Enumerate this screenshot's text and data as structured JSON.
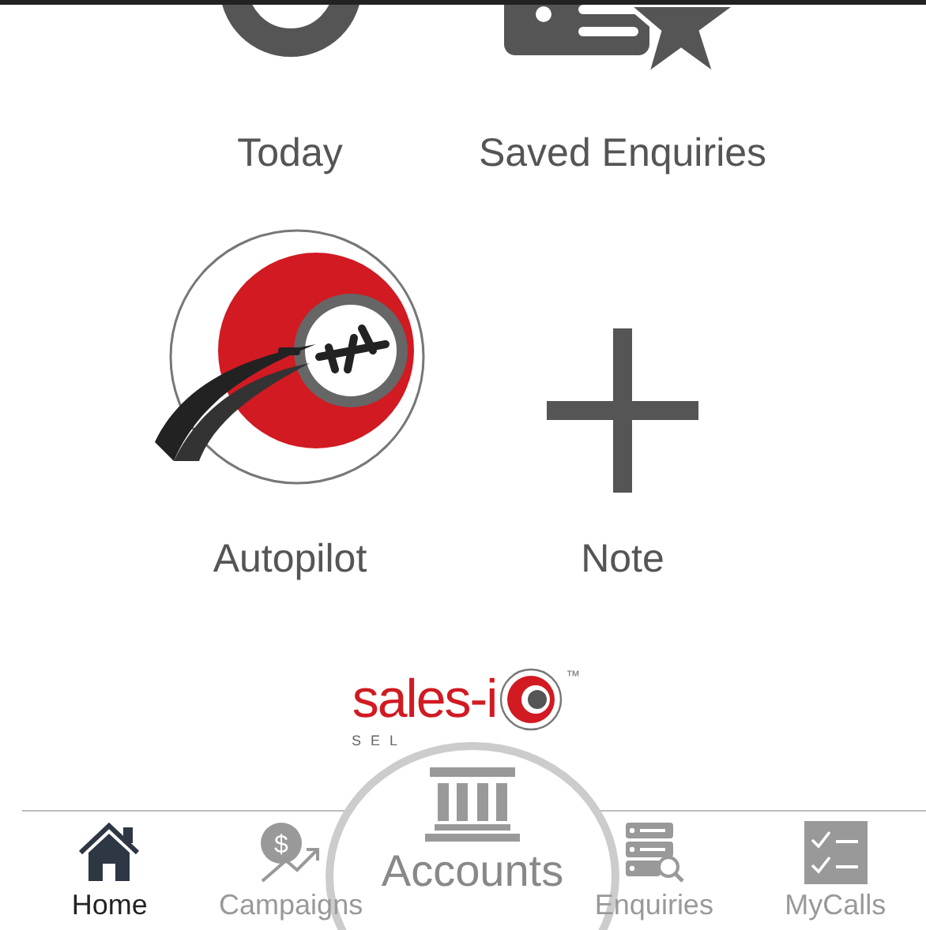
{
  "tiles": [
    {
      "label": "Today"
    },
    {
      "label": "Saved Enquiries"
    },
    {
      "label": "Autopilot"
    },
    {
      "label": "Note"
    }
  ],
  "logo": {
    "name": "sales-i",
    "tagline": "SEL",
    "trademark": "™"
  },
  "tabs": [
    {
      "label": "Home",
      "selected": true,
      "magnified": false
    },
    {
      "label": "Campaigns",
      "symbol": "$",
      "selected": false,
      "magnified": false
    },
    {
      "label": "Accounts",
      "selected": false,
      "magnified": true
    },
    {
      "label": "Enquiries",
      "selected": false,
      "magnified": false
    },
    {
      "label": "MyCalls",
      "selected": false,
      "magnified": false
    }
  ]
}
